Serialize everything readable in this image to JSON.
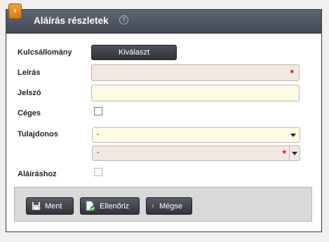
{
  "dialog": {
    "title": "Aláírás részletek",
    "help_icon": "question-circle-icon",
    "back_icon": "chevron-left-icon"
  },
  "form": {
    "keystore": {
      "label": "Kulcsállomány",
      "button": "Kiválaszt"
    },
    "description": {
      "label": "Leírás",
      "value": "",
      "required": true
    },
    "password": {
      "label": "Jelszó",
      "value": ""
    },
    "company": {
      "label": "Céges",
      "checked": false
    },
    "owner": {
      "label": "Tulajdonos",
      "select1": "-",
      "select2": "-",
      "select2_required": true
    },
    "for_signing": {
      "label": "Aláíráshoz",
      "checked": false,
      "enabled": false
    }
  },
  "footer": {
    "save": {
      "label": "Ment",
      "icon": "floppy-disk-icon"
    },
    "check": {
      "label": "Ellenőriz",
      "icon": "document-check-icon"
    },
    "cancel": {
      "label": "Mégse",
      "icon": "chevron-left-icon"
    }
  },
  "colors": {
    "titlebar": "#4f5561",
    "accent": "#e08b1a",
    "required_bg": "#f3e8e1",
    "optional_bg": "#fdfbe1",
    "required_star": "#c0201c"
  }
}
